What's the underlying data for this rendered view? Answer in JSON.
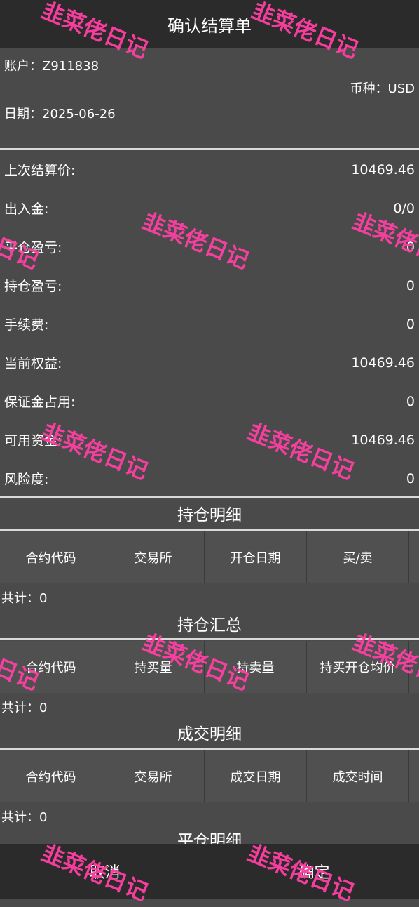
{
  "title": "确认结算单",
  "header": {
    "account": "账户：Z911838",
    "currency": "币种：USD",
    "date": "日期：2025-06-26"
  },
  "summary": [
    {
      "label": "上次结算价:",
      "value": "10469.46"
    },
    {
      "label": "出入金:",
      "value": "0/0"
    },
    {
      "label": "平仓盈亏:",
      "value": "0"
    },
    {
      "label": "持仓盈亏:",
      "value": "0"
    },
    {
      "label": "手续费:",
      "value": "0"
    },
    {
      "label": "当前权益:",
      "value": "10469.46"
    },
    {
      "label": "保证金占用:",
      "value": "0"
    },
    {
      "label": "可用资金:",
      "value": "10469.46"
    },
    {
      "label": "风险度:",
      "value": "0"
    }
  ],
  "sections": [
    {
      "title": "持仓明细",
      "columns": [
        "合约代码",
        "交易所",
        "开仓日期",
        "买/卖"
      ],
      "total": "共计：0"
    },
    {
      "title": "持仓汇总",
      "columns": [
        "合约代码",
        "持买量",
        "持卖量",
        "持买开仓均价"
      ],
      "total": "共计：0"
    },
    {
      "title": "成交明细",
      "columns": [
        "合约代码",
        "交易所",
        "成交日期",
        "成交时间"
      ],
      "total": "共计：0"
    },
    {
      "title": "平仓明细"
    }
  ],
  "buttons": {
    "cancel": "取消",
    "confirm": "确定"
  },
  "watermark": "韭菜佬日记",
  "colors": {
    "titlebar": "#2b2b2b",
    "background": "#4a4a4a",
    "watermark": "#ff3fa4"
  }
}
